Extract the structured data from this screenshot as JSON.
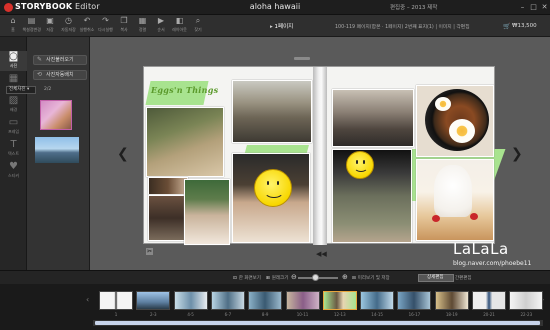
{
  "app": {
    "brand": "STORYBOOK",
    "editor": "Editor",
    "title": "aloha hawaii",
    "info": "편집중 – 2013 제작"
  },
  "toolbar": {
    "items": [
      {
        "icon": "home-icon",
        "label": "홈"
      },
      {
        "icon": "book-icon",
        "label": "책설정변경"
      },
      {
        "icon": "save-icon",
        "label": "저장"
      },
      {
        "icon": "clock-icon",
        "label": "자동저장"
      },
      {
        "icon": "undo-icon",
        "label": "실행취소"
      },
      {
        "icon": "redo-icon",
        "label": "다시실행"
      },
      {
        "icon": "copy-icon",
        "label": "복사"
      },
      {
        "icon": "grid-icon",
        "label": "정렬"
      },
      {
        "icon": "forward-icon",
        "label": "순서"
      },
      {
        "icon": "layers-icon",
        "label": "레이아웃"
      },
      {
        "icon": "search-icon",
        "label": "찾기"
      }
    ],
    "page_label": "1페이지",
    "status": "100-119 페이지(합본 · 1페이지)   2번째 표지(1)  |  이미지 | 각편집",
    "price": "₩13,500"
  },
  "iconbar": [
    {
      "icon": "camera-icon",
      "label": "사진",
      "active": true
    },
    {
      "icon": "layout-icon",
      "label": "레이아웃"
    },
    {
      "icon": "background-icon",
      "label": "배경"
    },
    {
      "icon": "frame-icon",
      "label": "프레임"
    },
    {
      "icon": "text-icon",
      "label": "텍스트"
    },
    {
      "icon": "sticker-icon",
      "label": "스티커"
    }
  ],
  "sidepanel": {
    "add_photo": "사진불러오기",
    "auto_place": "사진자동배치",
    "filter": "전체사진",
    "count": "2/2"
  },
  "canvas": {
    "title_text": "Eggs'n Things",
    "badge_left": "✂",
    "badge_right": "◀◀"
  },
  "watermark": {
    "logo": "LaLaLa",
    "url": "blog.naver.com/phoebe11"
  },
  "zoombar": {
    "fit": "한 화면보기",
    "actual": "원래크기",
    "fullscreen": "미리보기 및 저장",
    "toggle": "상세편집",
    "toggle2": "간편편집"
  },
  "filmstrip": {
    "pages": [
      "1",
      "2-3",
      "4-5",
      "6-7",
      "8-9",
      "10-11",
      "12-13",
      "14-15",
      "16-17",
      "18-19",
      "20-21",
      "22-23"
    ],
    "selected_index": 6
  },
  "colors": {
    "accent": "#e8a43c",
    "brand": "#d8312b",
    "highlight_green": "#a8e38f"
  }
}
